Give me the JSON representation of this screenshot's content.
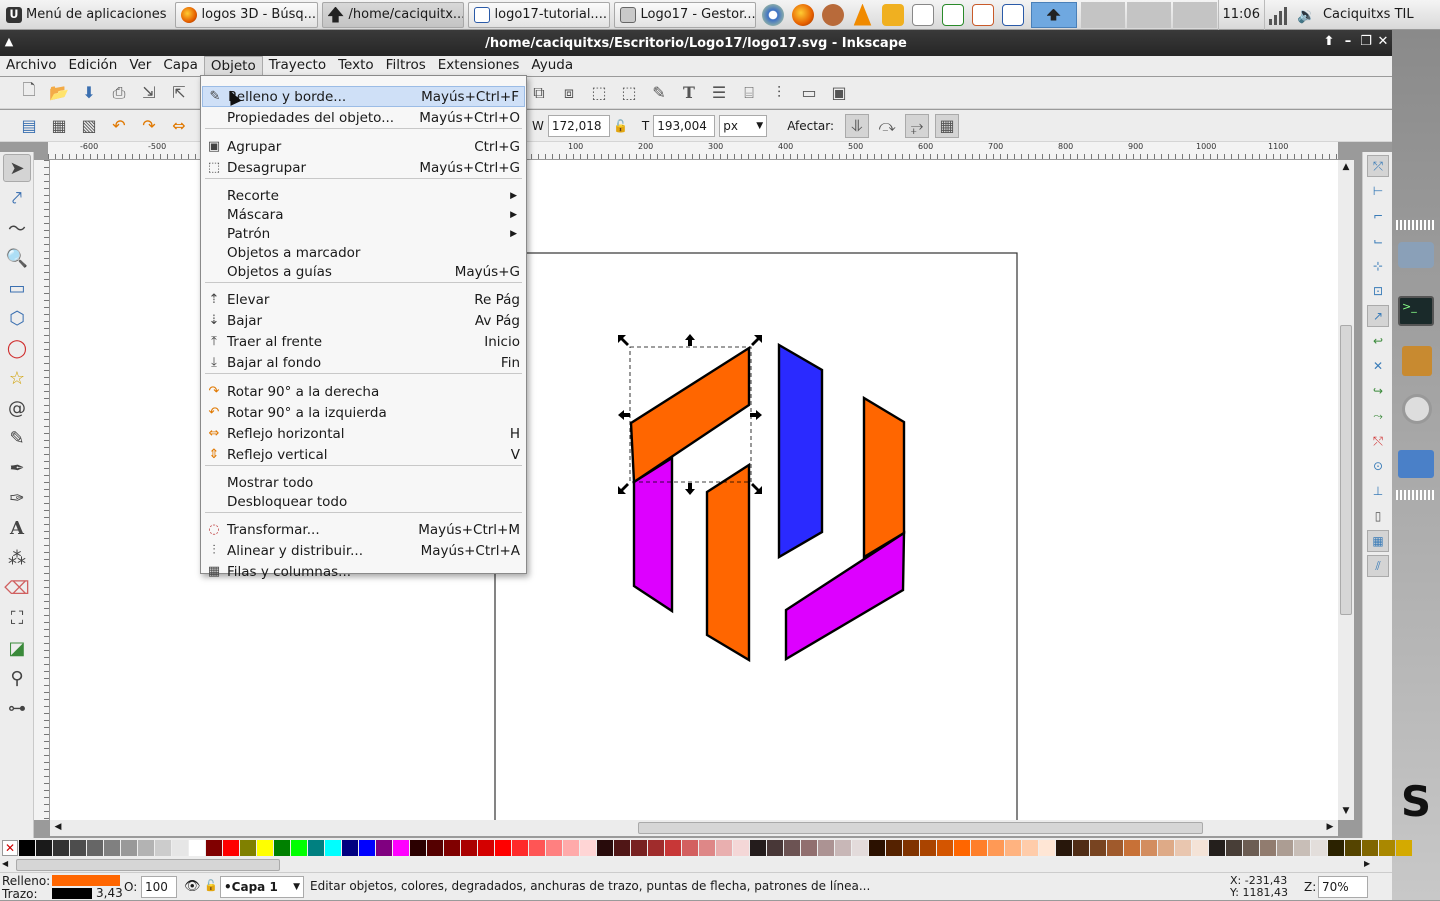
{
  "taskbar": {
    "start_label": "Menú de aplicaciones",
    "tasks": [
      {
        "label": "logos 3D - Búsq...",
        "icon": "firefox-icon"
      },
      {
        "label": "/home/caciquitx...",
        "icon": "inkscape-icon",
        "active": true
      },
      {
        "label": "logo17-tutorial....",
        "icon": "document-icon"
      },
      {
        "label": "Logo17 - Gestor...",
        "icon": "folder-icon"
      }
    ],
    "clock": "11:06",
    "user": "Caciquitxs TIL"
  },
  "window": {
    "title": "/home/caciquitxs/Escritorio/Logo17/logo17.svg - Inkscape"
  },
  "menubar": [
    "Archivo",
    "Edición",
    "Ver",
    "Capa",
    "Objeto",
    "Trayecto",
    "Texto",
    "Filtros",
    "Extensiones",
    "Ayuda"
  ],
  "open_menu": "Objeto",
  "dropdown": {
    "items": [
      {
        "label": "Relleno y borde...",
        "shortcut": "Mayús+Ctrl+F",
        "icon": "fill-stroke-icon",
        "highlighted": true
      },
      {
        "label": "Propiedades del objeto...",
        "shortcut": "Mayús+Ctrl+O",
        "icon": ""
      },
      {
        "label": "Agrupar",
        "shortcut": "Ctrl+G",
        "icon": "group-icon"
      },
      {
        "label": "Desagrupar",
        "shortcut": "Mayús+Ctrl+G",
        "icon": "ungroup-icon"
      },
      {
        "label": "Recorte",
        "shortcut": "",
        "submenu": true
      },
      {
        "label": "Máscara",
        "shortcut": "",
        "submenu": true
      },
      {
        "label": "Patrón",
        "shortcut": "",
        "submenu": true
      },
      {
        "label": "Objetos a marcador",
        "shortcut": ""
      },
      {
        "label": "Objetos a guías",
        "shortcut": "Mayús+G"
      },
      {
        "label": "Elevar",
        "shortcut": "Re Pág",
        "icon": "raise-icon"
      },
      {
        "label": "Bajar",
        "shortcut": "Av Pág",
        "icon": "lower-icon"
      },
      {
        "label": "Traer al frente",
        "shortcut": "Inicio",
        "icon": "raise-top-icon"
      },
      {
        "label": "Bajar al fondo",
        "shortcut": "Fin",
        "icon": "lower-bottom-icon"
      },
      {
        "label": "Rotar 90° a la derecha",
        "shortcut": "",
        "icon": "rotate-cw-icon"
      },
      {
        "label": "Rotar 90° a la izquierda",
        "shortcut": "",
        "icon": "rotate-ccw-icon"
      },
      {
        "label": "Reflejo horizontal",
        "shortcut": "H",
        "icon": "flip-horizontal-icon"
      },
      {
        "label": "Reflejo vertical",
        "shortcut": "V",
        "icon": "flip-vertical-icon"
      },
      {
        "label": "Mostrar todo",
        "shortcut": ""
      },
      {
        "label": "Desbloquear todo",
        "shortcut": ""
      },
      {
        "label": "Transformar...",
        "shortcut": "Mayús+Ctrl+M",
        "icon": "transform-icon"
      },
      {
        "label": "Alinear y distribuir...",
        "shortcut": "Mayús+Ctrl+A",
        "icon": "align-icon"
      },
      {
        "label": "Filas y columnas...",
        "shortcut": "",
        "icon": "grid-arrange-icon"
      }
    ]
  },
  "toolcontrols": {
    "w_label": "W",
    "w_value": "172,018",
    "h_label": "T",
    "h_value": "193,004",
    "unit": "px",
    "affect_label": "Afectar:"
  },
  "ruler": {
    "h_ticks": [
      "-600",
      "-500",
      "100",
      "200",
      "300",
      "400",
      "500",
      "600",
      "700",
      "800",
      "900",
      "1000",
      "1100"
    ]
  },
  "status": {
    "fill_label": "Relleno:",
    "stroke_label": "Trazo:",
    "stroke_width": "3,43",
    "opacity_label": "O:",
    "opacity_value": "100",
    "layer": "•Capa 1",
    "message": "Editar objetos, colores, degradados, anchuras de trazo, puntas de flecha, patrones de línea...",
    "x_coord": "X: -231,43",
    "y_coord": "Y: 1181,43",
    "zoom_label": "Z:",
    "zoom_value": "70%"
  },
  "colors": {
    "orange": "#ff6600",
    "purple": "#dd00ff",
    "blue": "#2a2aff",
    "fill_indicator": "#ff6600",
    "stroke_indicator": "#000000"
  },
  "palette": [
    "#000000",
    "#1a1a1a",
    "#333333",
    "#4d4d4d",
    "#666666",
    "#808080",
    "#999999",
    "#b3b3b3",
    "#cccccc",
    "#e6e6e6",
    "#ffffff",
    "#800000",
    "#ff0000",
    "#808000",
    "#ffff00",
    "#008000",
    "#00ff00",
    "#008080",
    "#00ffff",
    "#000080",
    "#0000ff",
    "#800080",
    "#ff00ff",
    "#2b0000",
    "#550000",
    "#800000",
    "#aa0000",
    "#d40000",
    "#ff0000",
    "#ff2a2a",
    "#ff5555",
    "#ff8080",
    "#ffaaaa",
    "#ffd5d5",
    "#280b0b",
    "#501616",
    "#782121",
    "#a02c2c",
    "#c83737",
    "#d35f5f",
    "#de8787",
    "#e9afaf",
    "#f4d7d7",
    "#241c1c",
    "#483737",
    "#6c5353",
    "#916f6f",
    "#ac9393",
    "#c8b7b7",
    "#e3dbdb",
    "#2b1100",
    "#552200",
    "#803300",
    "#aa4400",
    "#d45500",
    "#ff6600",
    "#ff7f2a",
    "#ff9955",
    "#ffb380",
    "#ffccaa",
    "#ffe6d5",
    "#28170b",
    "#502d16",
    "#784421",
    "#a05a2c",
    "#c87137",
    "#d38d5f",
    "#deaa87",
    "#e9c6af",
    "#f4e3d7",
    "#241f1c",
    "#483e37",
    "#6c5d53",
    "#917c6f",
    "#ac9d93",
    "#c8beb7",
    "#e3dedb",
    "#2b2200",
    "#554400",
    "#806600",
    "#aa8800",
    "#d4aa00"
  ]
}
